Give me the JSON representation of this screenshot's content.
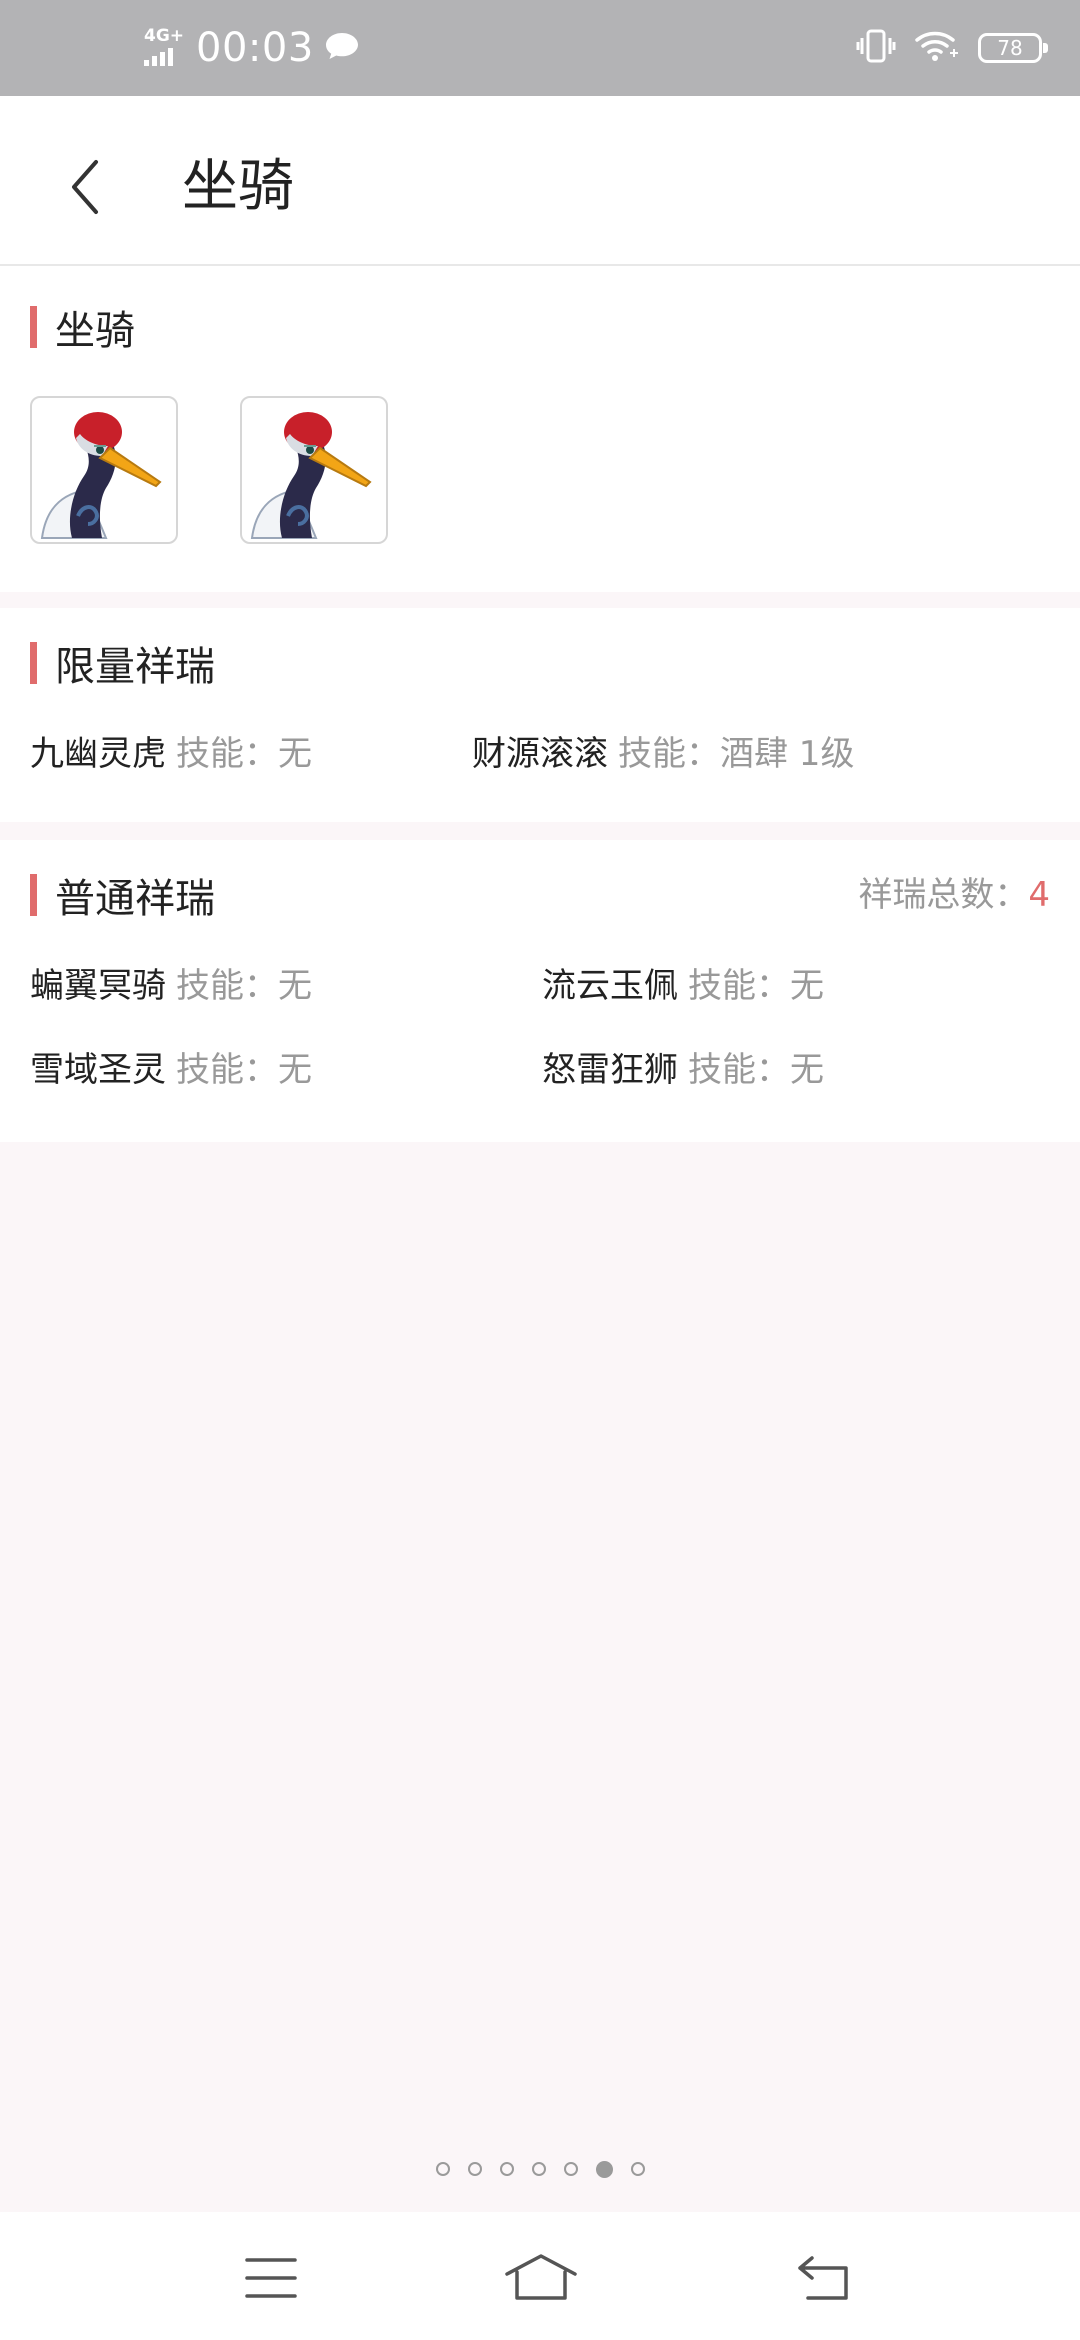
{
  "status_bar": {
    "network": "4G+",
    "time": "00:03",
    "battery": "78",
    "icons": [
      "signal-icon",
      "message-icon",
      "vibrate-icon",
      "wifi-icon",
      "battery-icon"
    ]
  },
  "header": {
    "title": "坐骑",
    "back_icon": "chevron-left-icon"
  },
  "mounts_section": {
    "title": "坐骑",
    "items": [
      {
        "icon": "crane-mount-icon"
      },
      {
        "icon": "crane-mount-icon"
      }
    ]
  },
  "limited_section": {
    "title": "限量祥瑞",
    "items": [
      {
        "name": "九幽灵虎",
        "skill": "技能：无"
      },
      {
        "name": "财源滚滚",
        "skill": "技能：酒肆 1级"
      }
    ]
  },
  "normal_section": {
    "title": "普通祥瑞",
    "total_label": "祥瑞总数：",
    "total_value": "4",
    "items": [
      {
        "name": "蝙翼冥骑",
        "skill": "技能：无"
      },
      {
        "name": "流云玉佩",
        "skill": "技能：无"
      },
      {
        "name": "雪域圣灵",
        "skill": "技能：无"
      },
      {
        "name": "怒雷狂狮",
        "skill": "技能：无"
      }
    ]
  },
  "pager": {
    "count": 7,
    "active_index": 5
  },
  "nav": {
    "icons": [
      "menu-icon",
      "home-icon",
      "back-icon"
    ]
  },
  "colors": {
    "accent": "#e06c6c",
    "status_bar": "#b3b3b5",
    "background": "#fbf6f8"
  }
}
